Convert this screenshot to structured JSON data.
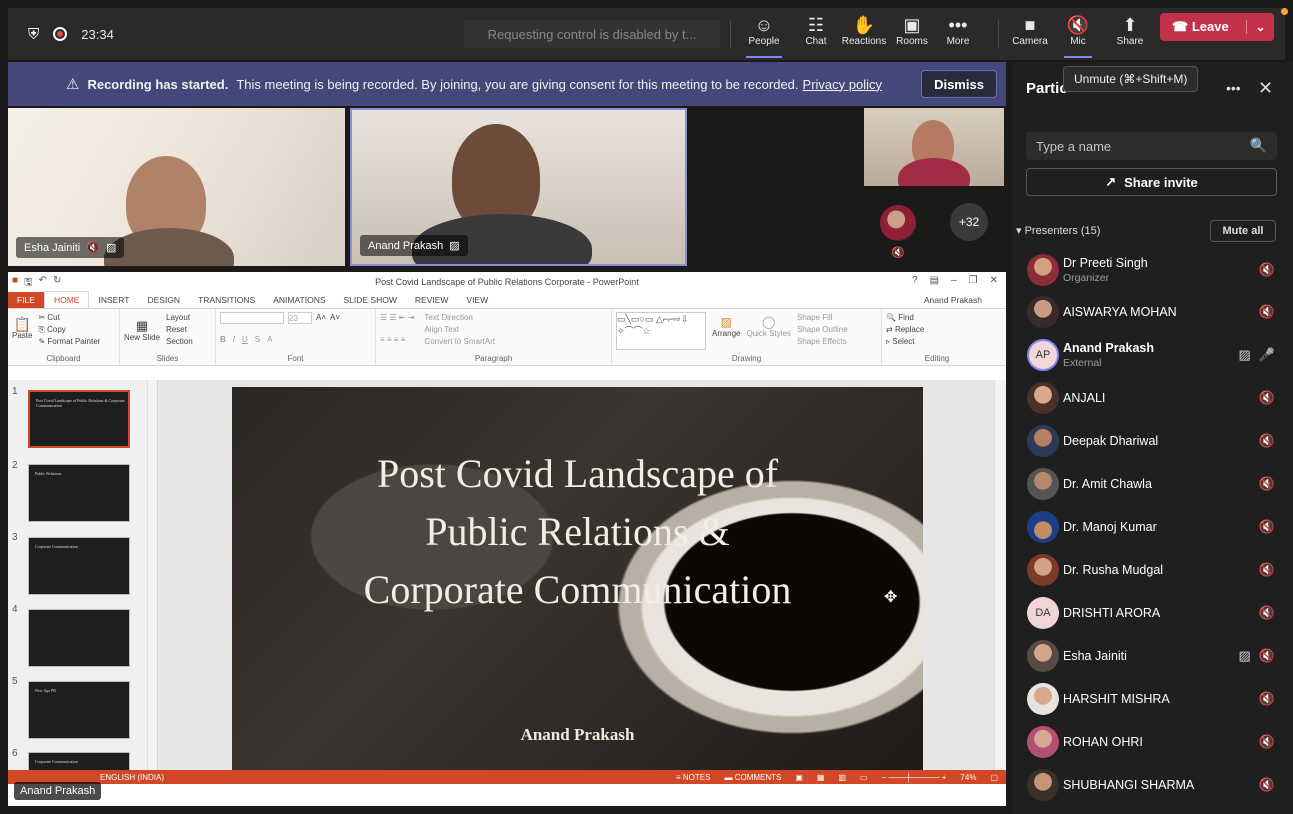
{
  "topbar": {
    "timer": "23:34",
    "request_control": "Requesting control is disabled by t...",
    "buttons": [
      {
        "icon": "people-icon",
        "label": "People"
      },
      {
        "icon": "chat-icon",
        "label": "Chat"
      },
      {
        "icon": "reactions-icon",
        "label": "Reactions"
      },
      {
        "icon": "rooms-icon",
        "label": "Rooms"
      },
      {
        "icon": "more-icon",
        "label": "More"
      },
      {
        "icon": "camera-icon",
        "label": "Camera"
      },
      {
        "icon": "mic-off-icon",
        "label": "Mic"
      },
      {
        "icon": "share-icon",
        "label": "Share"
      }
    ],
    "leave_label": "Leave"
  },
  "banner": {
    "bold": "Recording has started.",
    "text": "This meeting is being recorded. By joining, you are giving consent for this meeting to be recorded.",
    "link": "Privacy policy",
    "dismiss": "Dismiss"
  },
  "videos": {
    "tile1_name": "Esha Jainiti",
    "tile2_name": "Anand Prakash",
    "overflow_count": "+32"
  },
  "powerpoint": {
    "window_title": "Post Covid Landscape of Public Relations Corporate - PowerPoint",
    "user": "Anand Prakash",
    "tabs": [
      "FILE",
      "HOME",
      "INSERT",
      "DESIGN",
      "TRANSITIONS",
      "ANIMATIONS",
      "SLIDE SHOW",
      "REVIEW",
      "VIEW"
    ],
    "groups": {
      "clipboard": {
        "label": "Clipboard",
        "paste": "Paste",
        "cut": "Cut",
        "copy": "Copy",
        "format_painter": "Format Painter"
      },
      "slides": {
        "label": "Slides",
        "new_slide": "New Slide",
        "layout": "Layout",
        "reset": "Reset",
        "section": "Section"
      },
      "font": {
        "label": "Font",
        "size": "23"
      },
      "paragraph": {
        "label": "Paragraph",
        "text_direction": "Text Direction",
        "align_text": "Align Text",
        "convert": "Convert to SmartArt"
      },
      "drawing": {
        "label": "Drawing",
        "arrange": "Arrange",
        "quick_styles": "Quick Styles",
        "shape_fill": "Shape Fill",
        "shape_outline": "Shape Outline",
        "shape_effects": "Shape Effects"
      },
      "editing": {
        "label": "Editing",
        "find": "Find",
        "replace": "Replace",
        "select": "Select"
      }
    },
    "thumb_numbers": [
      "1",
      "2",
      "3",
      "4",
      "5",
      "6"
    ],
    "thumb_titles": [
      "Post Covid Landscape of Public Relations & Corporate Communication",
      "Public Relations",
      "Corporate Communication",
      "",
      "New Age PR",
      "Corporate Communication"
    ],
    "slide_title_lines": [
      "Post Covid Landscape of",
      "Public Relations &",
      "Corporate Communication"
    ],
    "slide_author": "Anand Prakash",
    "status_lang": "ENGLISH (INDIA)",
    "status_notes": "NOTES",
    "status_comments": "COMMENTS",
    "zoom": "74%",
    "presenter_tag": "Anand Prakash"
  },
  "panel": {
    "title": "Partic",
    "tooltip": "Unmute (⌘+Shift+M)",
    "search_placeholder": "Type a name",
    "share_invite": "Share invite",
    "presenters_label": "Presenters (15)",
    "mute_all": "Mute all",
    "participants": [
      {
        "name": "Dr Preeti  Singh",
        "sub": "Organizer",
        "avatar": "photo",
        "icons": [
          "mic-off-icon"
        ]
      },
      {
        "name": "AISWARYA MOHAN",
        "sub": "",
        "avatar": "photo",
        "icons": [
          "mic-off-icon"
        ]
      },
      {
        "name": "Anand Prakash",
        "sub": "External",
        "avatar": "AP",
        "icons": [
          "sharing-icon",
          "mic-icon"
        ]
      },
      {
        "name": "ANJALI",
        "sub": "",
        "avatar": "photo",
        "icons": [
          "mic-off-icon"
        ]
      },
      {
        "name": "Deepak Dhariwal",
        "sub": "",
        "avatar": "photo",
        "icons": [
          "mic-off-icon"
        ]
      },
      {
        "name": "Dr. Amit Chawla",
        "sub": "",
        "avatar": "photo",
        "icons": [
          "mic-off-icon"
        ]
      },
      {
        "name": "Dr. Manoj Kumar",
        "sub": "",
        "avatar": "photo",
        "icons": [
          "mic-off-icon"
        ]
      },
      {
        "name": "Dr. Rusha Mudgal",
        "sub": "",
        "avatar": "photo",
        "icons": [
          "mic-off-icon"
        ]
      },
      {
        "name": "DRISHTI ARORA",
        "sub": "",
        "avatar": "DA",
        "icons": [
          "mic-off-icon"
        ]
      },
      {
        "name": "Esha Jainiti",
        "sub": "",
        "avatar": "photo",
        "icons": [
          "sharing-icon",
          "mic-off-icon"
        ]
      },
      {
        "name": "HARSHIT MISHRA",
        "sub": "",
        "avatar": "photo",
        "icons": [
          "mic-off-icon"
        ]
      },
      {
        "name": "ROHAN OHRI",
        "sub": "",
        "avatar": "photo",
        "icons": [
          "mic-off-icon"
        ]
      },
      {
        "name": "SHUBHANGI SHARMA",
        "sub": "",
        "avatar": "photo",
        "icons": [
          "mic-off-icon"
        ]
      }
    ]
  },
  "colors": {
    "accent": "#7f85f5",
    "leave": "#c4314b",
    "banner": "#434779",
    "ppt": "#d24726"
  }
}
